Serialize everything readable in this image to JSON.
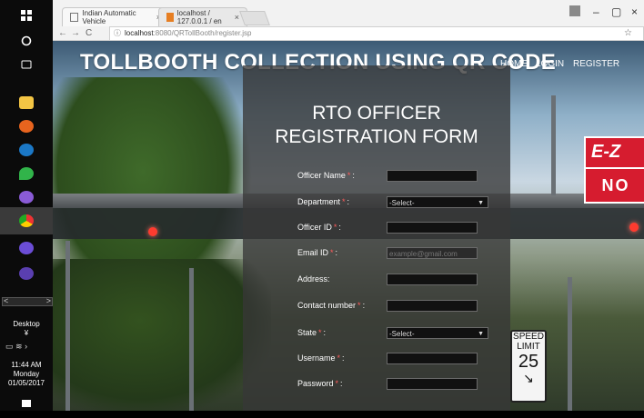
{
  "taskbar": {
    "tray_time": "11:44 AM",
    "tray_day": "Monday",
    "tray_date": "01/05/2017",
    "desktop_label": "Desktop",
    "scroll_left": "<",
    "scroll_right": ">"
  },
  "browser": {
    "tab1_title": "Indian Automatic Vehicle",
    "tab2_title": "localhost / 127.0.0.1 / en",
    "url_host": "localhost",
    "url_path": ":8080/QRTollBooth/register.jsp",
    "back": "←",
    "forward": "→",
    "reload": "C",
    "star": "☆"
  },
  "header": {
    "title": "TOLLBOOTH COLLECTION USING QR CODE",
    "nav": [
      "HOME",
      "LOGIN",
      "REGISTER"
    ]
  },
  "scene": {
    "sign_ez": "E-Z",
    "sign_no": "NO",
    "speed_limit": [
      "SPEED",
      "LIMIT",
      "25"
    ]
  },
  "form": {
    "title_line1": "RTO OFFICER",
    "title_line2": "REGISTRATION FORM",
    "fields": [
      {
        "label": "Officer Name",
        "value": ""
      },
      {
        "label": "Department",
        "value": "-Select-"
      },
      {
        "label": "Officer ID",
        "value": ""
      },
      {
        "label": "Email ID",
        "placeholder": "example@gmail.com"
      },
      {
        "label": "Address:",
        "value": ""
      },
      {
        "label": "Contact number",
        "value": ""
      },
      {
        "label": "State",
        "value": "-Select-"
      },
      {
        "label": "Username",
        "value": ""
      },
      {
        "label": "Password",
        "value": ""
      }
    ]
  },
  "colors": {
    "accent": "#2e9d3a",
    "required_star": "#ff5b5b",
    "panel": "#373737"
  }
}
